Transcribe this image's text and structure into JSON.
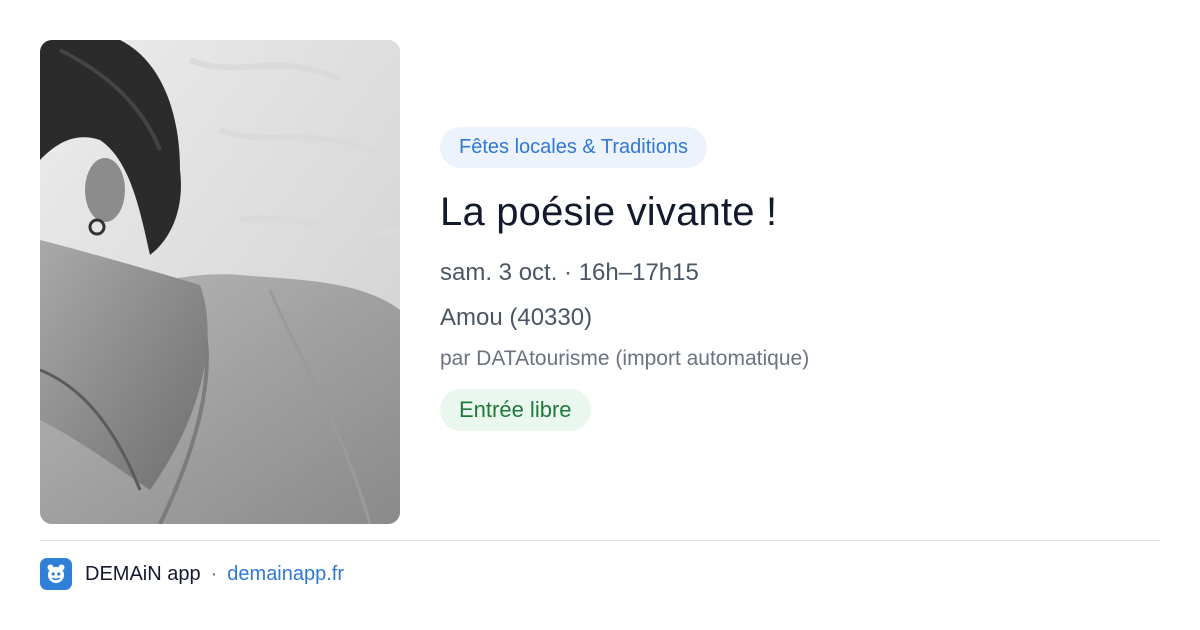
{
  "event": {
    "category": "Fêtes locales & Traditions",
    "title": "La poésie vivante !",
    "datetime": "sam. 3 oct. · 16h–17h15",
    "location": "Amou (40330)",
    "organizer": "par DATAtourisme (import automatique)",
    "price": "Entrée libre",
    "image_icon": "portrait-photo"
  },
  "footer": {
    "app_name": "DEMAiN app",
    "separator": "·",
    "site": "demainapp.fr",
    "logo_icon": "demain-logo-icon"
  },
  "colors": {
    "category_bg": "#edf3fd",
    "category_text": "#2f78d4",
    "price_bg": "#eaf7ee",
    "price_text": "#1f7a3a",
    "title_text": "#141a2e",
    "link": "#2f78d4",
    "logo_bg": "#2f80d6"
  }
}
